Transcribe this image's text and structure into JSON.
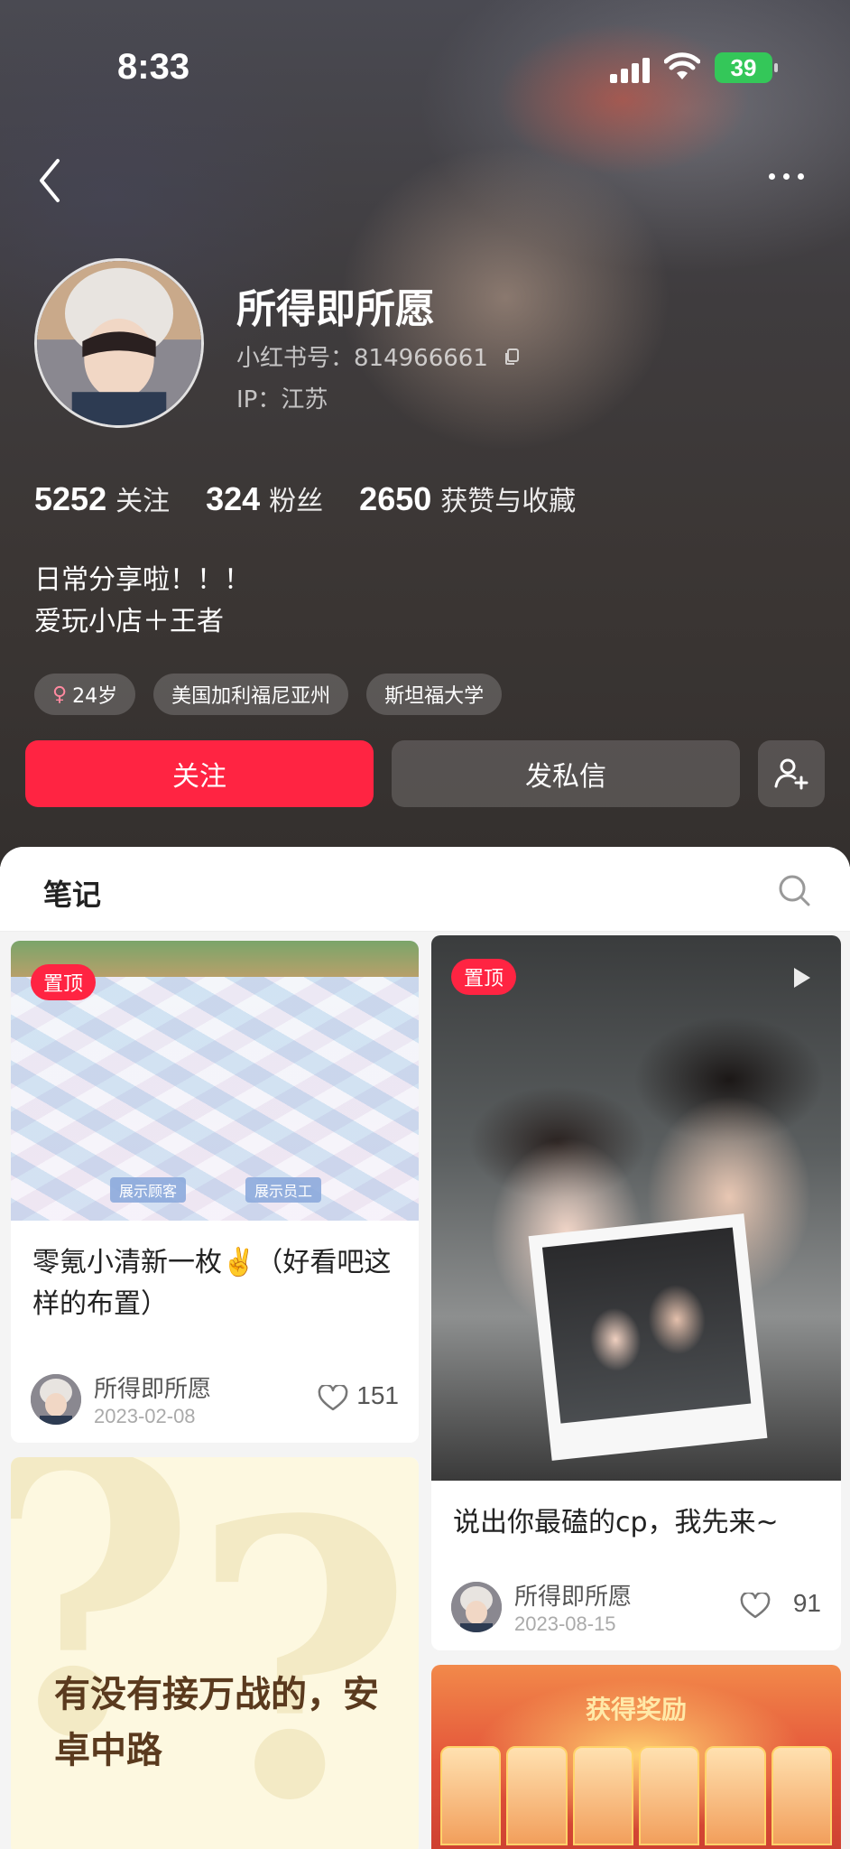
{
  "status_bar": {
    "time": "8:33",
    "battery": "39"
  },
  "profile": {
    "username": "所得即所愿",
    "redbook_id": "小红书号：814966661",
    "ip_location": "IP：江苏",
    "stats": [
      {
        "value": "5252",
        "label": "关注"
      },
      {
        "value": "324",
        "label": "粉丝"
      },
      {
        "value": "2650",
        "label": "获赞与收藏"
      }
    ],
    "bio_lines": [
      "日常分享啦！！！",
      "爱玩小店＋王者"
    ],
    "tags": {
      "gender_icon": "♀",
      "age": "24岁",
      "location": "美国加利福尼亚州",
      "school": "斯坦福大学"
    },
    "follow_label": "关注",
    "message_label": "发私信"
  },
  "notes": {
    "tab_label": "笔记",
    "posts": [
      {
        "badge": "置顶",
        "title": "零氪小清新一枚✌️（好看吧这样的布置）",
        "author": "所得即所愿",
        "date": "2023-02-08",
        "likes": "151",
        "image_tags": [
          "展示顾客",
          "展示员工"
        ]
      },
      {
        "badge": "置顶",
        "title": "说出你最磕的cp，我先来~",
        "author": "所得即所愿",
        "date": "2023-08-15",
        "likes": "91"
      },
      {
        "image_text": "有没有接万战的，安卓中路"
      },
      {
        "image_text": "获得奖励"
      }
    ]
  },
  "colors": {
    "accent": "#ff2442",
    "hero_bg": "#3b3634"
  }
}
